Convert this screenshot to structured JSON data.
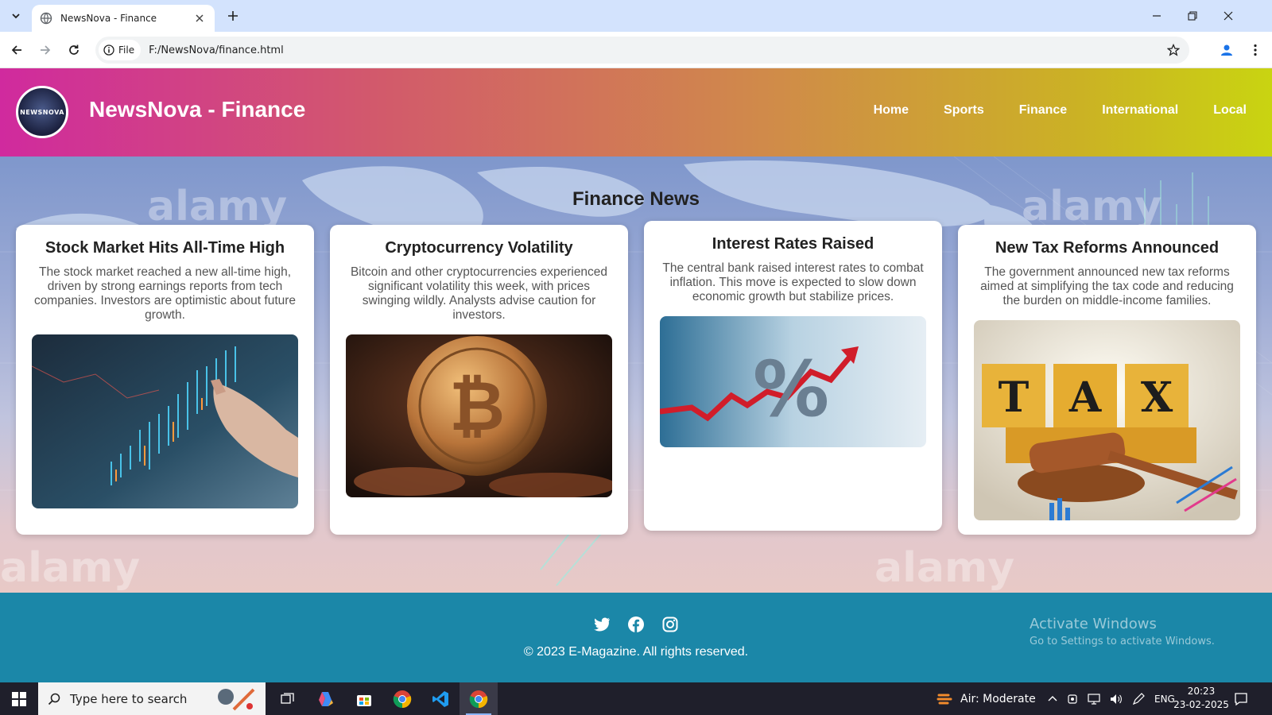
{
  "browser": {
    "tab_title": "NewsNova - Finance",
    "site_chip": "File",
    "url": "F:/NewsNova/finance.html"
  },
  "header": {
    "logo_text": "NEWSNOVA",
    "site_title": "NewsNova - Finance",
    "nav": [
      "Home",
      "Sports",
      "Finance",
      "International",
      "Local"
    ]
  },
  "main": {
    "section_title": "Finance News",
    "cards": [
      {
        "title": "Stock Market Hits All-Time High",
        "body": "The stock market reached a new all-time high, driven by strong earnings reports from tech companies. Investors are optimistic about future growth.",
        "image": "stock-chart-touch-image"
      },
      {
        "title": "Cryptocurrency Volatility",
        "body": "Bitcoin and other cryptocurrencies experienced significant volatility this week, with prices swinging wildly. Analysts advise caution for investors.",
        "image": "bitcoin-coin-image"
      },
      {
        "title": "Interest Rates Raised",
        "body": "The central bank raised interest rates to combat inflation. This move is expected to slow down economic growth but stabilize prices.",
        "image": "percent-arrow-image",
        "image_text": "%"
      },
      {
        "title": "New Tax Reforms Announced",
        "body": "The government announced new tax reforms aimed at simplifying the tax code and reducing the burden on middle-income families.",
        "image": "tax-gavel-image",
        "image_text": [
          "T",
          "A",
          "X"
        ]
      }
    ]
  },
  "footer": {
    "social": [
      "twitter-icon",
      "facebook-icon",
      "instagram-icon"
    ],
    "copyright": "© 2023 E-Magazine. All rights reserved.",
    "activate_title": "Activate Windows",
    "activate_sub": "Go to Settings to activate Windows."
  },
  "watermark": "alamy",
  "taskbar": {
    "search_placeholder": "Type here to search",
    "weather": "Air: Moderate",
    "language": "ENG",
    "time": "20:23",
    "date": "23-02-2025"
  }
}
